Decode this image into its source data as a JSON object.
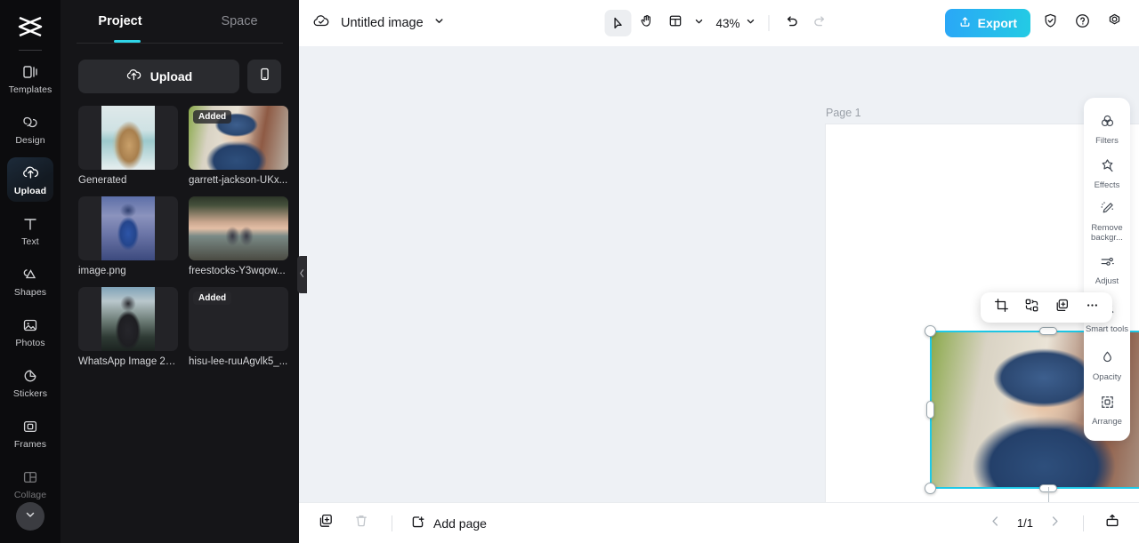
{
  "rail": {
    "logo_icon": "capcut-logo-icon",
    "items": [
      {
        "label": "Templates",
        "icon": "templates-icon",
        "active": false
      },
      {
        "label": "Design",
        "icon": "design-icon",
        "active": false
      },
      {
        "label": "Upload",
        "icon": "upload-cloud-icon",
        "active": true
      },
      {
        "label": "Text",
        "icon": "text-icon",
        "active": false
      },
      {
        "label": "Shapes",
        "icon": "shapes-icon",
        "active": false
      },
      {
        "label": "Photos",
        "icon": "photos-icon",
        "active": false
      },
      {
        "label": "Stickers",
        "icon": "stickers-icon",
        "active": false
      },
      {
        "label": "Frames",
        "icon": "frames-icon",
        "active": false
      },
      {
        "label": "Collage",
        "icon": "collage-icon",
        "active": false
      }
    ],
    "expand_icon": "chevron-down-icon"
  },
  "panel": {
    "tabs": [
      {
        "label": "Project",
        "active": true
      },
      {
        "label": "Space",
        "active": false
      }
    ],
    "accent_color": "#2fd5e8",
    "upload_label": "Upload",
    "upload_icon": "upload-cloud-icon",
    "phone_icon": "mobile-phone-icon",
    "collapse_icon": "chevron-left-icon",
    "assets": [
      {
        "name": "Generated",
        "badge": "",
        "art": "art-dogs",
        "orient": "portrait"
      },
      {
        "name": "garrett-jackson-UKx...",
        "badge": "Added",
        "art": "art-boy",
        "orient": "fill"
      },
      {
        "name": "image.png",
        "badge": "",
        "art": "art-cricket",
        "orient": "portrait"
      },
      {
        "name": "freestocks-Y3wqow...",
        "badge": "",
        "art": "art-lake",
        "orient": "fill"
      },
      {
        "name": "WhatsApp Image 20...",
        "badge": "",
        "art": "art-man",
        "orient": "portrait"
      },
      {
        "name": "hisu-lee-ruuAgvlk5_...",
        "badge": "Added",
        "art": "art-street",
        "orient": "fill"
      }
    ]
  },
  "topbar": {
    "cloud_icon": "cloud-saved-icon",
    "doc_name": "Untitled image",
    "doc_menu_icon": "chevron-down-icon",
    "tools": [
      {
        "name": "select-tool",
        "icon": "cursor-arrow-icon",
        "selected": true
      },
      {
        "name": "hand-tool",
        "icon": "hand-icon",
        "selected": false
      },
      {
        "name": "layout-tool",
        "icon": "layout-grid-icon",
        "selected": false
      }
    ],
    "layout_chevron_icon": "chevron-down-icon",
    "zoom_level": "43%",
    "zoom_chevron_icon": "chevron-down-icon",
    "undo_icon": "undo-icon",
    "redo_icon": "redo-icon",
    "export_label": "Export",
    "export_icon": "export-upload-icon",
    "export_color": "#23cbe4",
    "shield_icon": "shield-check-icon",
    "help_icon": "question-circle-icon",
    "settings_icon": "settings-gear-icon"
  },
  "canvas": {
    "page_label": "Page 1",
    "page_duplicate_icon": "duplicate-page-icon",
    "page_more_icon": "more-horizontal-icon",
    "selection_color": "#1ec9e8",
    "rotate_icon": "rotate-icon",
    "object_toolbar": [
      {
        "name": "crop-button",
        "icon": "crop-icon"
      },
      {
        "name": "replace-button",
        "icon": "swap-replace-icon"
      },
      {
        "name": "duplicate-button",
        "icon": "duplicate-icon"
      },
      {
        "name": "more-button",
        "icon": "more-horizontal-icon"
      }
    ],
    "images": [
      {
        "name": "street-sunset-photo",
        "art": "art-sunset",
        "selected": false
      },
      {
        "name": "boy-in-cap-photo",
        "art": "art-boy",
        "selected": true
      }
    ]
  },
  "dock": {
    "items": [
      {
        "label": "Filters",
        "icon": "filters-icon"
      },
      {
        "label": "Effects",
        "icon": "effects-icon"
      },
      {
        "label": "Remove backgr...",
        "icon": "remove-background-icon"
      },
      {
        "label": "Adjust",
        "icon": "adjust-sliders-icon"
      },
      {
        "label": "Smart tools",
        "icon": "smart-tools-icon"
      },
      {
        "label": "Opacity",
        "icon": "opacity-droplet-icon"
      },
      {
        "label": "Arrange",
        "icon": "arrange-icon"
      }
    ]
  },
  "bottombar": {
    "duplicate_icon": "duplicate-page-icon",
    "delete_icon": "trash-icon",
    "add_page_label": "Add page",
    "add_page_icon": "add-page-icon",
    "prev_icon": "chevron-left-icon",
    "next_icon": "chevron-right-icon",
    "page_count": "1/1",
    "present_icon": "present-icon"
  }
}
